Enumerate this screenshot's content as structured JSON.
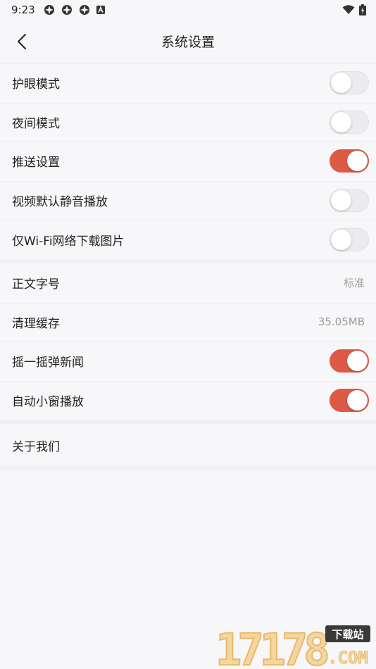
{
  "status_bar": {
    "time": "9:23",
    "icons": [
      "app-notification-icon",
      "app-notification-icon",
      "app-notification-icon",
      "a-badge-icon",
      "wifi-icon",
      "battery-icon"
    ]
  },
  "header": {
    "title": "系统设置",
    "back_icon": "chevron-left-icon"
  },
  "groups": [
    {
      "rows": [
        {
          "label": "护眼模式",
          "type": "toggle",
          "on": false
        },
        {
          "label": "夜间模式",
          "type": "toggle",
          "on": false
        },
        {
          "label": "推送设置",
          "type": "toggle",
          "on": true
        },
        {
          "label": "视频默认静音播放",
          "type": "toggle",
          "on": false
        },
        {
          "label": "仅Wi-Fi网络下载图片",
          "type": "toggle",
          "on": false
        }
      ]
    },
    {
      "rows": [
        {
          "label": "正文字号",
          "type": "value",
          "value": "标准"
        },
        {
          "label": "清理缓存",
          "type": "value",
          "value": "35.05MB"
        },
        {
          "label": "摇一摇弹新闻",
          "type": "toggle",
          "on": true
        },
        {
          "label": "自动小窗播放",
          "type": "toggle",
          "on": true
        }
      ]
    },
    {
      "rows": [
        {
          "label": "关于我们",
          "type": "link"
        }
      ]
    }
  ],
  "colors": {
    "accent": "#dd5a46",
    "background": "#f7f7f9",
    "toggle_off": "#ececee"
  },
  "watermark": {
    "digits": "17178",
    "badge": "下载站",
    "domain": ".COM"
  }
}
